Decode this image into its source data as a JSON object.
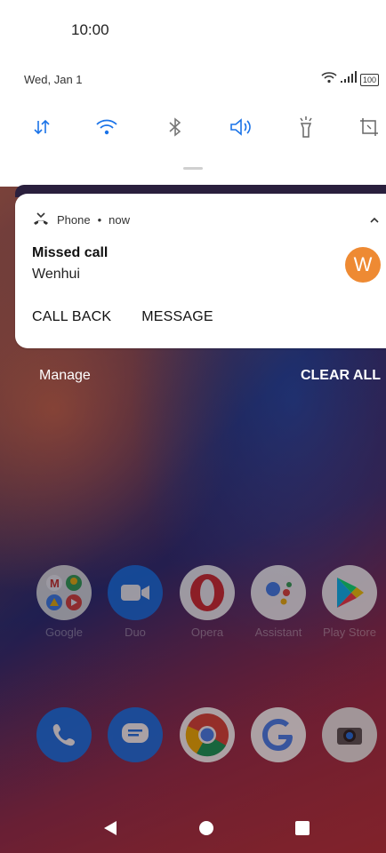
{
  "status_bar": {
    "time": "10:00",
    "battery": "100"
  },
  "shade": {
    "date": "Wed, Jan 1"
  },
  "quick_settings": [
    {
      "icon": "data-transfer-icon",
      "active": true
    },
    {
      "icon": "wifi-icon",
      "active": true
    },
    {
      "icon": "bluetooth-icon",
      "active": false
    },
    {
      "icon": "sound-icon",
      "active": true
    },
    {
      "icon": "flashlight-icon",
      "active": false
    },
    {
      "icon": "auto-rotate-icon",
      "active": false
    }
  ],
  "notification": {
    "app_name": "Phone",
    "separator": "•",
    "time": "now",
    "title": "Missed call",
    "body": "Wenhui",
    "avatar_letter": "W",
    "avatar_color": "#ee8a33",
    "actions": {
      "call_back": "CALL BACK",
      "message": "MESSAGE"
    }
  },
  "footer": {
    "manage": "Manage",
    "clear_all": "CLEAR ALL"
  },
  "apps": [
    {
      "label": "Google"
    },
    {
      "label": "Duo"
    },
    {
      "label": "Opera"
    },
    {
      "label": "Assistant"
    },
    {
      "label": "Play Store"
    }
  ],
  "colors": {
    "accent": "#1a73e8",
    "avatar": "#ee8a33"
  }
}
